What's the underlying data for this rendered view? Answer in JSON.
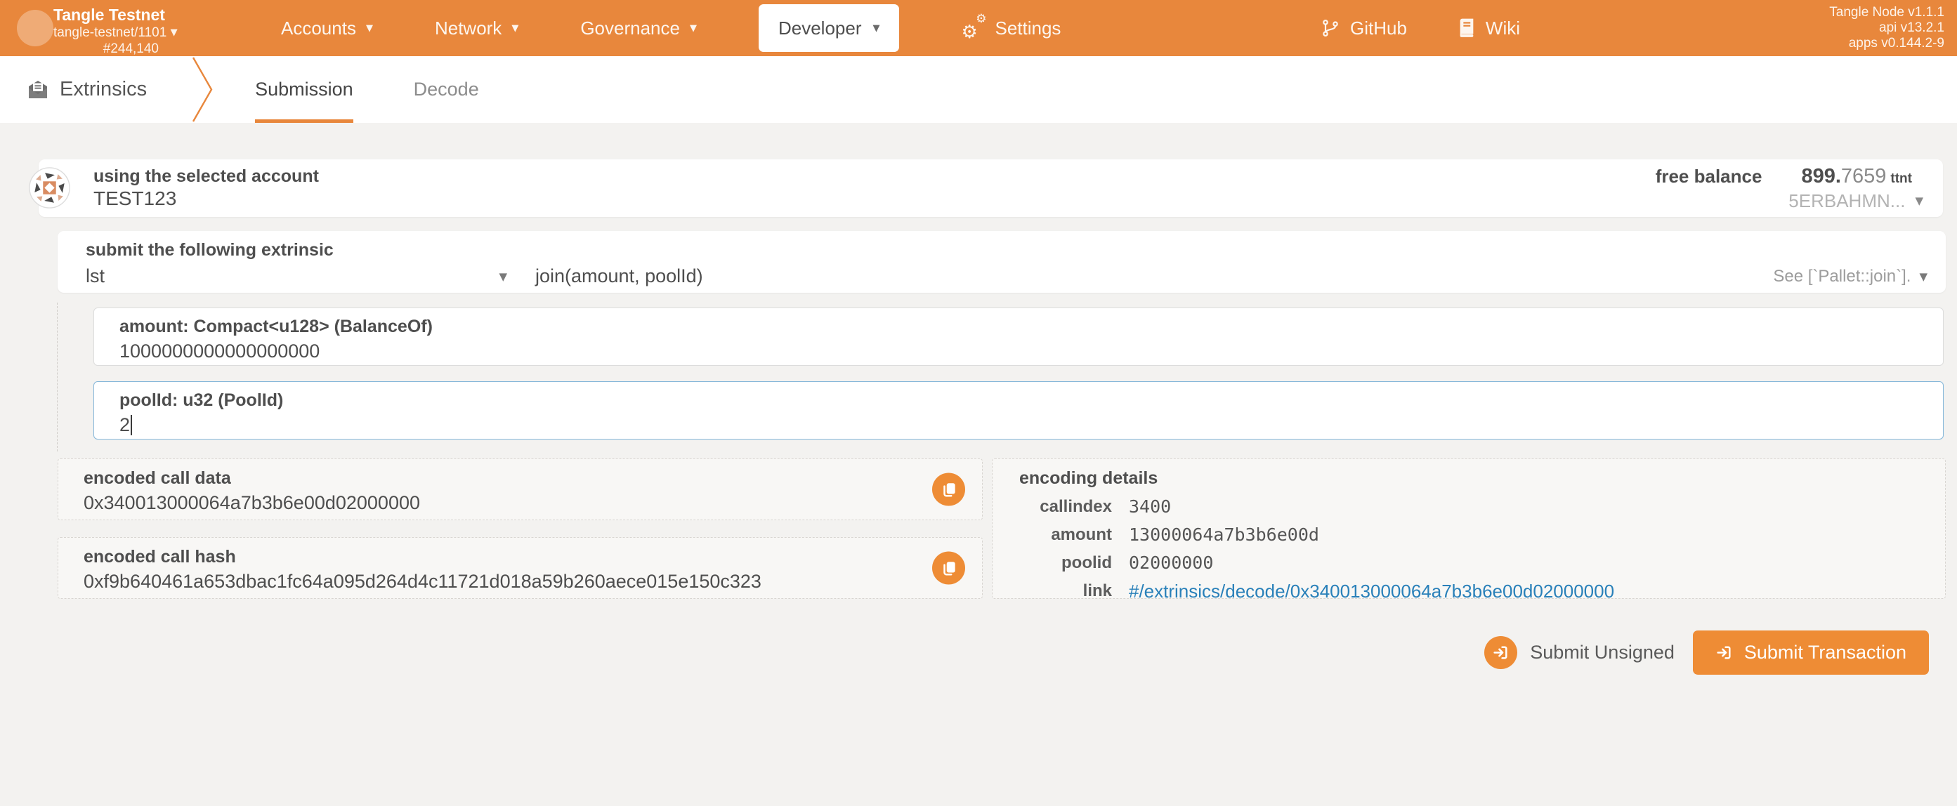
{
  "colors": {
    "header_bg": "#e8873c",
    "accent_button": "#ee8c35",
    "tab_underline": "#e8873c",
    "link": "#2980b9",
    "focus_border": "#85b7d9",
    "page_bg": "#f3f2f0"
  },
  "header": {
    "chain_name": "Tangle Testnet",
    "network_path": "tangle-testnet/1101",
    "best_block": "#244,140",
    "nav": {
      "accounts": "Accounts",
      "network": "Network",
      "governance": "Governance",
      "developer": "Developer",
      "settings": "Settings"
    },
    "external": {
      "github": "GitHub",
      "wiki": "Wiki"
    },
    "versions": {
      "node": "Tangle Node v1.1.1",
      "api": "api v13.2.1",
      "apps": "apps v0.144.2-9"
    }
  },
  "tabbar": {
    "section": "Extrinsics",
    "tab_submission": "Submission",
    "tab_decode": "Decode"
  },
  "account": {
    "label": "using the selected account",
    "name": "TEST123",
    "balance_label": "free balance",
    "balance_main": "899.",
    "balance_frac": "7659",
    "balance_unit": "ttnt",
    "address": "5ERBAHMN..."
  },
  "extrinsic": {
    "label": "submit the following extrinsic",
    "pallet": "lst",
    "method": "join(amount, poolId)",
    "doc": "See [`Pallet::join`]."
  },
  "params": {
    "amount": {
      "label": "amount: Compact<u128> (BalanceOf)",
      "value": "1000000000000000000"
    },
    "poolId": {
      "label": "poolId: u32 (PoolId)",
      "value": "2"
    }
  },
  "output": {
    "call_data_label": "encoded call data",
    "call_data": "0x340013000064a7b3b6e00d02000000",
    "call_hash_label": "encoded call hash",
    "call_hash": "0xf9b640461a653dbac1fc64a095d264d4c11721d018a59b260aece015e150c323"
  },
  "details": {
    "title": "encoding details",
    "rows": [
      {
        "key": "callindex",
        "value": "3400"
      },
      {
        "key": "amount",
        "value": "13000064a7b3b6e00d"
      },
      {
        "key": "poolid",
        "value": "02000000"
      },
      {
        "key": "link",
        "value": "#/extrinsics/decode/0x340013000064a7b3b6e00d02000000"
      }
    ]
  },
  "actions": {
    "unsigned": "Submit Unsigned",
    "submit": "Submit Transaction"
  }
}
